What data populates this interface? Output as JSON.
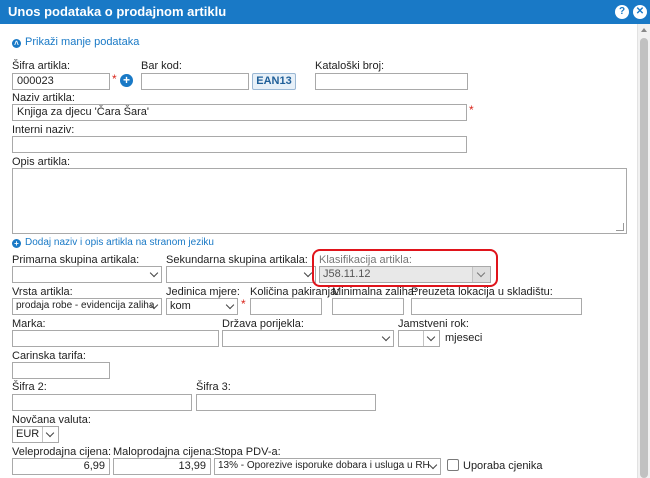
{
  "window": {
    "title": "Unos podataka o prodajnom artiklu",
    "help_label": "?",
    "close_label": "✕"
  },
  "toggle_link": "Prikaži manje podataka",
  "fields": {
    "sifra_label": "Šifra artikla:",
    "sifra_value": "000023",
    "barkod_label": "Bar kod:",
    "barkod_value": "",
    "ean_label": "EAN13",
    "katalog_label": "Kataloški broj:",
    "katalog_value": "",
    "naziv_label": "Naziv artikla:",
    "naziv_value": "Knjiga za djecu 'Čara Šara'",
    "interni_label": "Interni naziv:",
    "interni_value": "",
    "opis_label": "Opis artikla:",
    "lang_link": "Dodaj naziv i opis artikla na stranom jeziku",
    "primarna_label": "Primarna skupina artikala:",
    "primarna_value": "",
    "sekundarna_label": "Sekundarna skupina artikala:",
    "sekundarna_value": "",
    "klasif_label": "Klasifikacija artikla:",
    "klasif_value": "J58.11.12",
    "vrsta_label": "Vrsta artikla:",
    "vrsta_value": "prodaja robe - evidencija zaliha",
    "jedinica_label": "Jedinica mjere:",
    "jedinica_value": "kom",
    "kolicina_label": "Količina pakiranja:",
    "kolicina_value": "",
    "minzal_label": "Minimalna zaliha:",
    "minzal_value": "",
    "lokacija_label": "Preuzeta lokacija u skladištu:",
    "lokacija_value": "",
    "marka_label": "Marka:",
    "marka_value": "",
    "drzava_label": "Država porijekla:",
    "drzava_value": "",
    "jamstvo_label": "Jamstveni rok:",
    "jamstvo_value": "",
    "jamstvo_unit": "mjeseci",
    "carinska_label": "Carinska tarifa:",
    "carinska_value": "",
    "sifra2_label": "Šifra 2:",
    "sifra2_value": "",
    "sifra3_label": "Šifra 3:",
    "sifra3_value": "",
    "valuta_label": "Novčana valuta:",
    "valuta_value": "EUR",
    "vpc_label": "Veleprodajna cijena:",
    "vpc_value": "6,99",
    "mpc_label": "Maloprodajna cijena:",
    "mpc_value": "13,99",
    "pdv_label": "Stopa PDV-a:",
    "pdv_value": "13% - Oporezive isporuke dobara i usluga u RH",
    "cjenik_label": "Uporaba cjenika"
  },
  "required_mark": "*",
  "colors": {
    "titlebar": "#1979c6",
    "highlight": "#e0141b",
    "required": "#d9261c"
  }
}
